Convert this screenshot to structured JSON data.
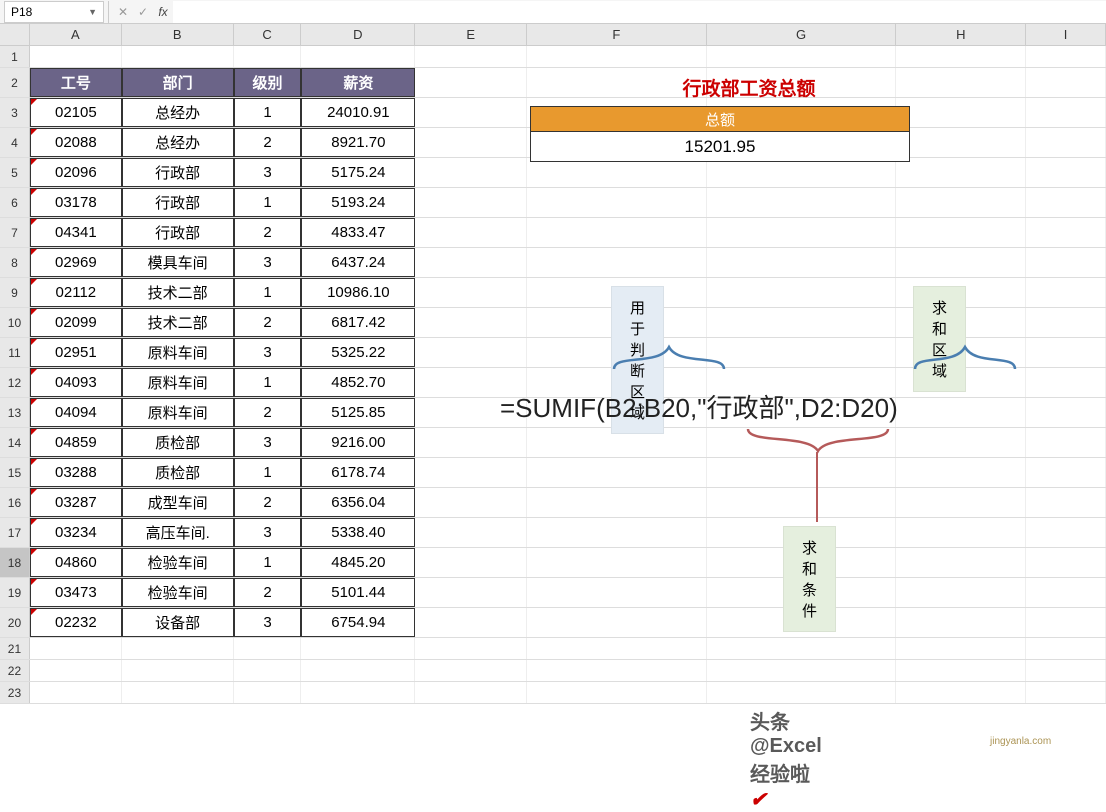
{
  "nameBox": "P18",
  "formulaBar": "",
  "columns": [
    "A",
    "B",
    "C",
    "D",
    "E",
    "F",
    "G",
    "H",
    "I"
  ],
  "rowCount": 23,
  "headers": {
    "A": "工号",
    "B": "部门",
    "C": "级别",
    "D": "薪资"
  },
  "table": [
    {
      "A": "02105",
      "B": "总经办",
      "C": "1",
      "D": "24010.91"
    },
    {
      "A": "02088",
      "B": "总经办",
      "C": "2",
      "D": "8921.70"
    },
    {
      "A": "02096",
      "B": "行政部",
      "C": "3",
      "D": "5175.24"
    },
    {
      "A": "03178",
      "B": "行政部",
      "C": "1",
      "D": "5193.24"
    },
    {
      "A": "04341",
      "B": "行政部",
      "C": "2",
      "D": "4833.47"
    },
    {
      "A": "02969",
      "B": "模具车间",
      "C": "3",
      "D": "6437.24"
    },
    {
      "A": "02112",
      "B": "技术二部",
      "C": "1",
      "D": "10986.10"
    },
    {
      "A": "02099",
      "B": "技术二部",
      "C": "2",
      "D": "6817.42"
    },
    {
      "A": "02951",
      "B": "原料车间",
      "C": "3",
      "D": "5325.22"
    },
    {
      "A": "04093",
      "B": "原料车间",
      "C": "1",
      "D": "4852.70"
    },
    {
      "A": "04094",
      "B": "原料车间",
      "C": "2",
      "D": "5125.85"
    },
    {
      "A": "04859",
      "B": "质检部",
      "C": "3",
      "D": "9216.00"
    },
    {
      "A": "03288",
      "B": "质检部",
      "C": "1",
      "D": "6178.74"
    },
    {
      "A": "03287",
      "B": "成型车间",
      "C": "2",
      "D": "6356.04"
    },
    {
      "A": "03234",
      "B": "高压车间.",
      "C": "3",
      "D": "5338.40"
    },
    {
      "A": "04860",
      "B": "检验车间",
      "C": "1",
      "D": "4845.20"
    },
    {
      "A": "03473",
      "B": "检验车间",
      "C": "2",
      "D": "5101.44"
    },
    {
      "A": "02232",
      "B": "设备部",
      "C": "3",
      "D": "6754.94"
    }
  ],
  "summary": {
    "title": "行政部工资总额",
    "headerLabel": "总额",
    "value": "15201.95"
  },
  "callouts": {
    "range": "用于判断区域",
    "sumRange": "求和区域",
    "criteria": "求和条件"
  },
  "formula": "=SUMIF(B2:B20,\"行政部\",D2:D20)",
  "watermark": "头条 @Excel 经验啦",
  "watermarkUrl": "jingyanla.com",
  "selectedRow": 18
}
